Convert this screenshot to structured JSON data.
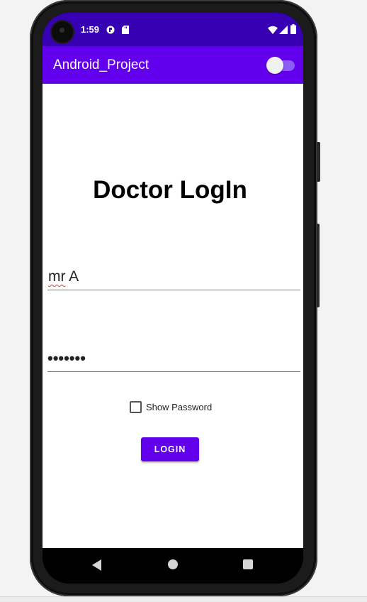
{
  "status_bar": {
    "time": "1:59",
    "icons": [
      "camera-icon",
      "app-notification-icon",
      "sd-card-icon",
      "wifi-icon",
      "signal-icon",
      "battery-icon"
    ]
  },
  "app_bar": {
    "title": "Android_Project",
    "toggle_state": "off"
  },
  "form": {
    "heading": "Doctor LogIn",
    "username_value_underlined": "mr",
    "username_value_rest": " A",
    "password_value": "•••••••",
    "show_password_label": "Show Password",
    "show_password_checked": false,
    "login_button_label": "LOGIN"
  },
  "nav_bar": {
    "icons": [
      "back-icon",
      "home-icon",
      "recents-icon"
    ]
  },
  "colors": {
    "status_bar": "#3700b3",
    "app_bar": "#6200ee",
    "button": "#6200ee",
    "background": "#ffffff"
  }
}
